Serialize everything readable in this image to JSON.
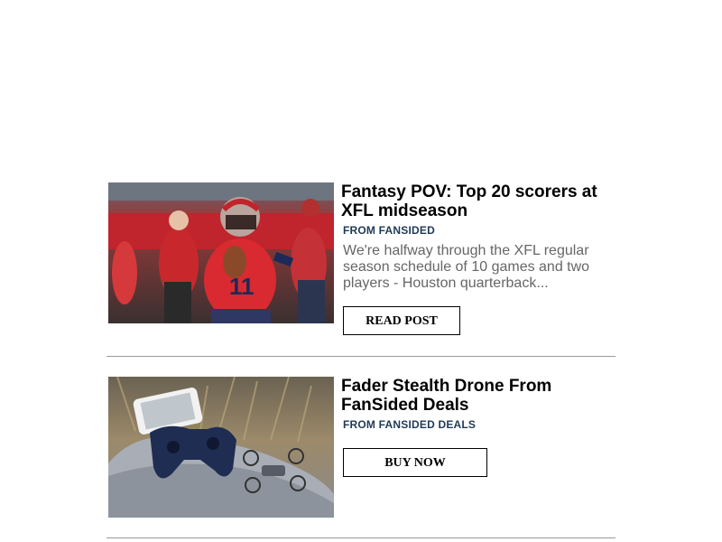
{
  "articles": [
    {
      "title": "Fantasy POV: Top 20 scorers at XFL midseason",
      "source": "FROM FANSIDED",
      "excerpt": "We're halfway through the XFL regular season schedule of 10 games and two players - Houston quarterback...",
      "cta": "READ POST",
      "image": "football-quarterback-photo"
    },
    {
      "title": "Fader Stealth Drone From FanSided Deals",
      "source": "FROM FANSIDED DEALS",
      "cta": "BUY NOW",
      "image": "drone-and-controller-photo"
    }
  ],
  "colors": {
    "source": "#1f3a57",
    "excerpt": "#666666",
    "divider": "#9a9a9a"
  }
}
